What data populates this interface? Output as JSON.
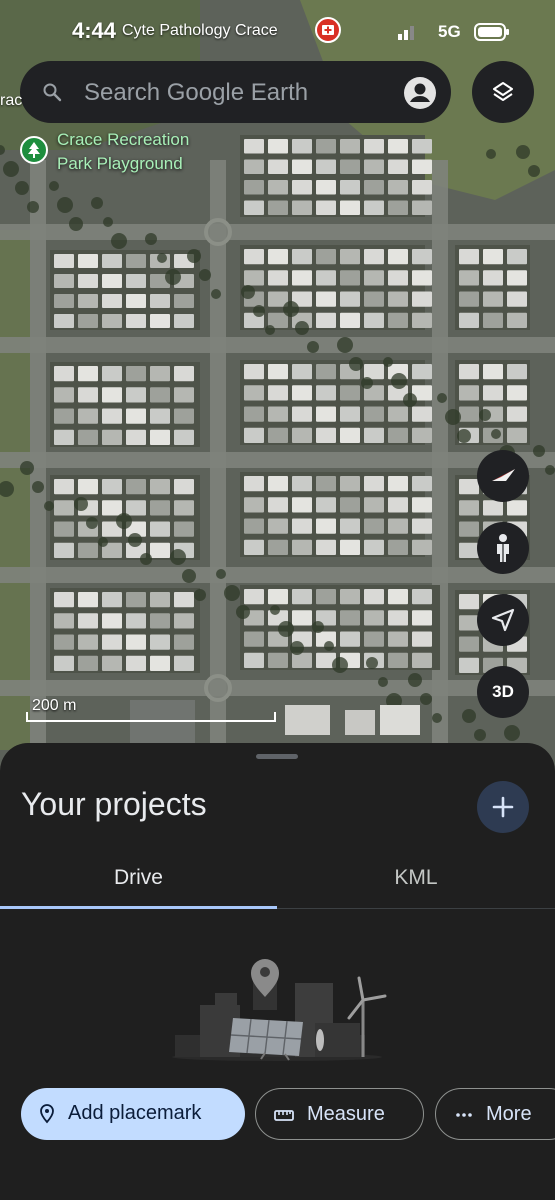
{
  "status_bar": {
    "time": "4:44",
    "network": "5G",
    "notification_text": "Cyte Pathology Crace"
  },
  "search": {
    "placeholder": "Search Google Earth"
  },
  "map": {
    "left_label": "rac",
    "park_label": "Crace Recreation Park Playground",
    "park_label_line1": "Crace Recreation",
    "park_label_line2": "Park Playground",
    "scale": "200 m",
    "control_3d": "3D"
  },
  "icons": {
    "search": "search-icon",
    "account": "account-icon",
    "layers": "layers-icon",
    "compass": "compass-icon",
    "streetview": "pegman-icon",
    "location": "location-arrow-icon",
    "add": "plus-icon",
    "placemark": "placemark-icon",
    "measure": "ruler-icon",
    "more": "more-dots-icon"
  },
  "sheet": {
    "title": "Your projects",
    "tabs": [
      {
        "label": "Drive",
        "selected": true
      },
      {
        "label": "KML",
        "selected": false
      }
    ],
    "actions": {
      "add_placemark": "Add placemark",
      "measure": "Measure",
      "more": "More"
    }
  },
  "colors": {
    "sheet_bg": "#1f1f1f",
    "accent_chip": "#c2dcff",
    "tab_indicator": "#a8c7fa",
    "poi_red": "#d93025",
    "park_green": "#1e8e3e"
  }
}
